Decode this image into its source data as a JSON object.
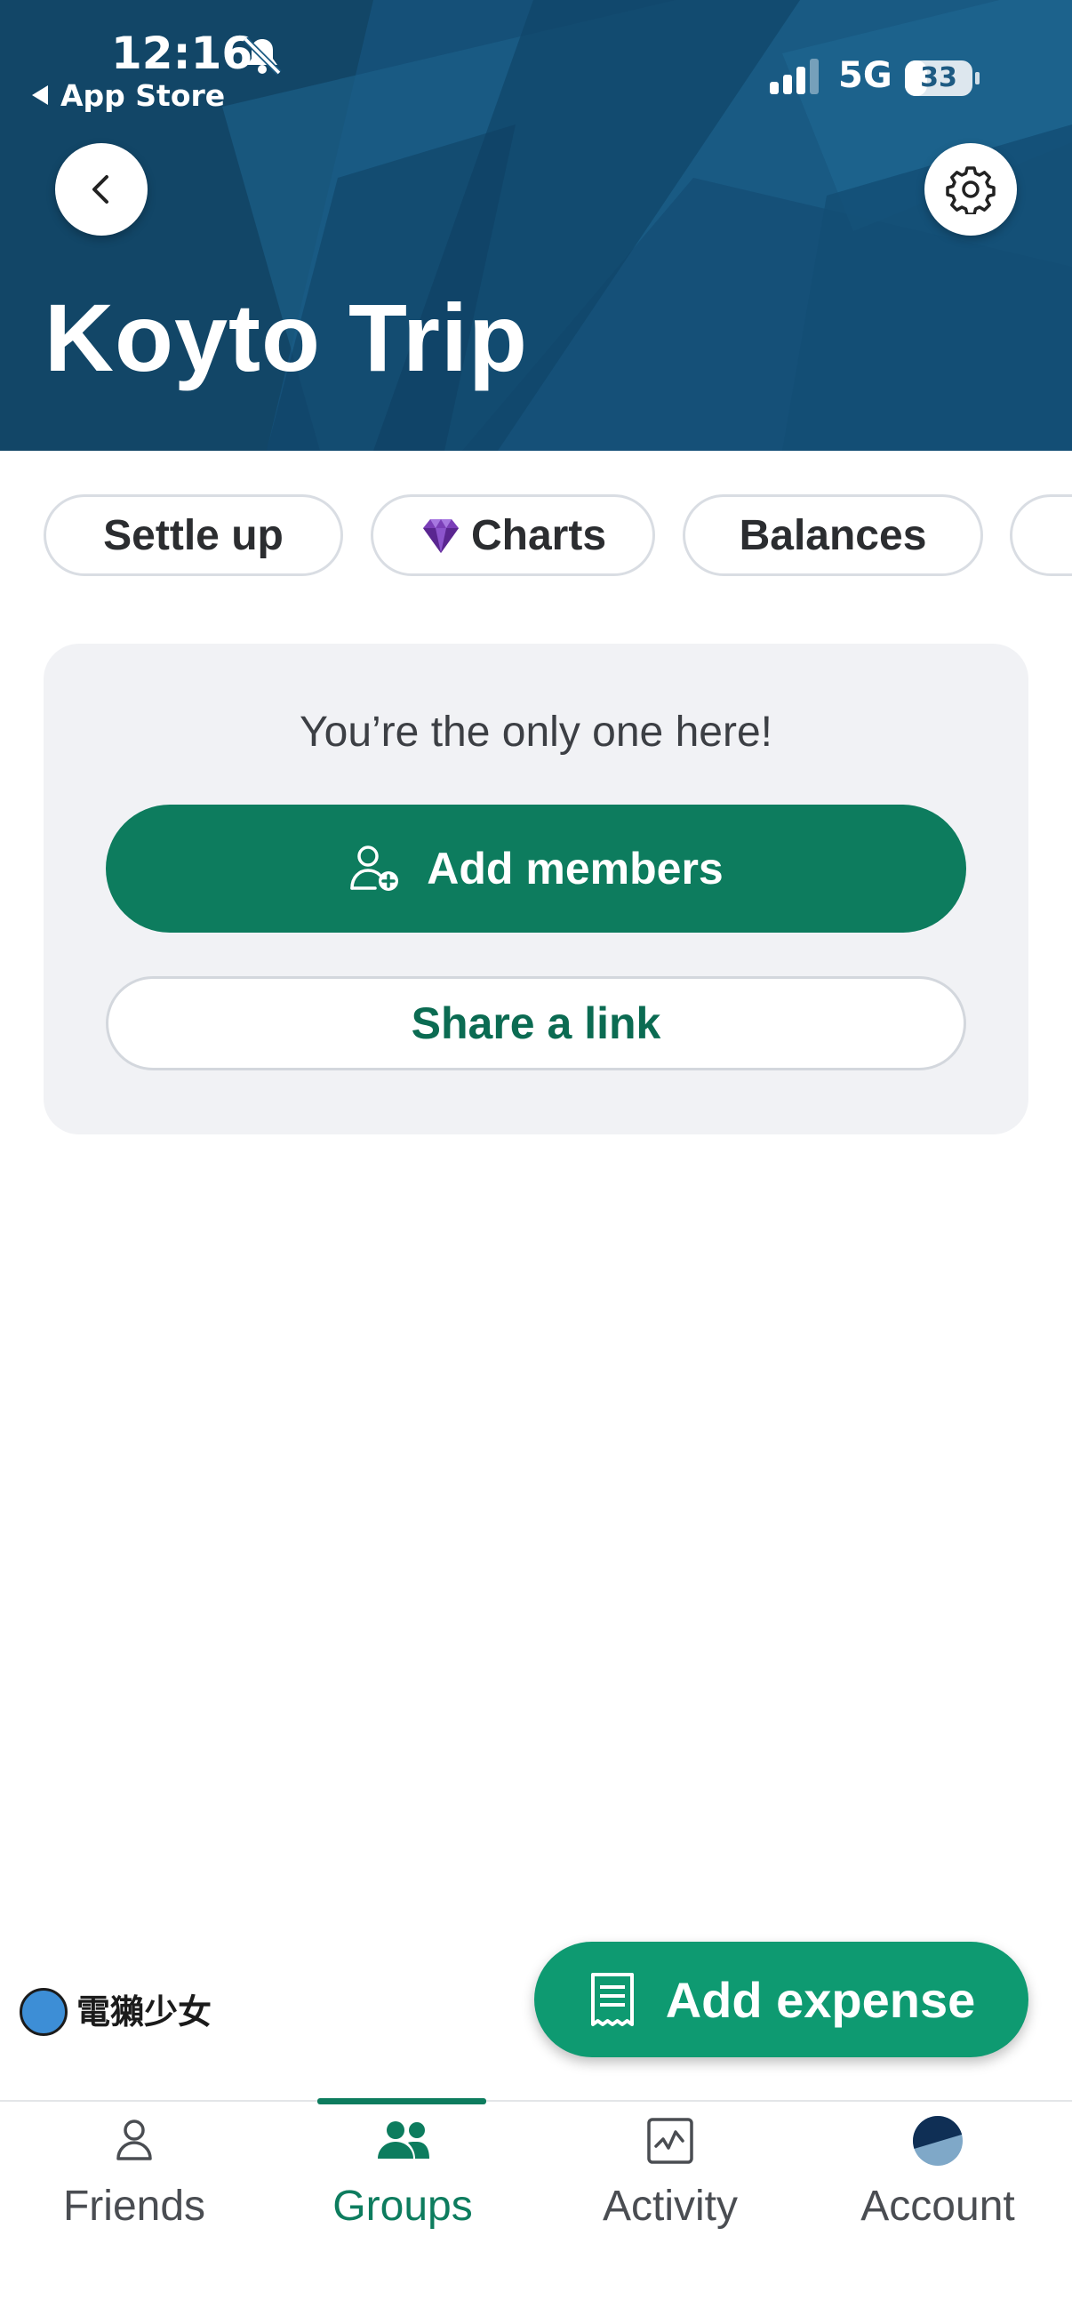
{
  "status_bar": {
    "time": "12:16",
    "back_app": "App Store",
    "network": "5G",
    "battery": "33",
    "battery_level_percent": 33,
    "signal_bars_filled": 3,
    "icons": [
      "bell-slash-icon",
      "signal-icon",
      "battery-icon"
    ]
  },
  "header": {
    "title": "Koyto Trip",
    "background_color": "#154f76",
    "icons": [
      "chevron-left-icon",
      "gear-icon"
    ]
  },
  "chips": [
    {
      "label": "Settle up"
    },
    {
      "label": "Charts",
      "icon": "gem-icon"
    },
    {
      "label": "Balances"
    },
    {
      "label": ""
    }
  ],
  "empty_state": {
    "message": "You’re the only one here!",
    "primary_button": "Add members",
    "primary_icon": "add-person-icon",
    "secondary_button": "Share a link"
  },
  "watermark": {
    "text": "電獺少女"
  },
  "fab": {
    "label": "Add expense",
    "icon": "receipt-icon",
    "color": "#0e9a71"
  },
  "bottom_nav": {
    "active": "Groups",
    "items": [
      {
        "label": "Friends",
        "icon": "person-icon"
      },
      {
        "label": "Groups",
        "icon": "group-icon"
      },
      {
        "label": "Activity",
        "icon": "activity-icon"
      },
      {
        "label": "Account",
        "icon": "avatar-icon"
      }
    ]
  },
  "colors": {
    "accent": "#0d7c5e",
    "card_bg": "#f1f2f5"
  }
}
